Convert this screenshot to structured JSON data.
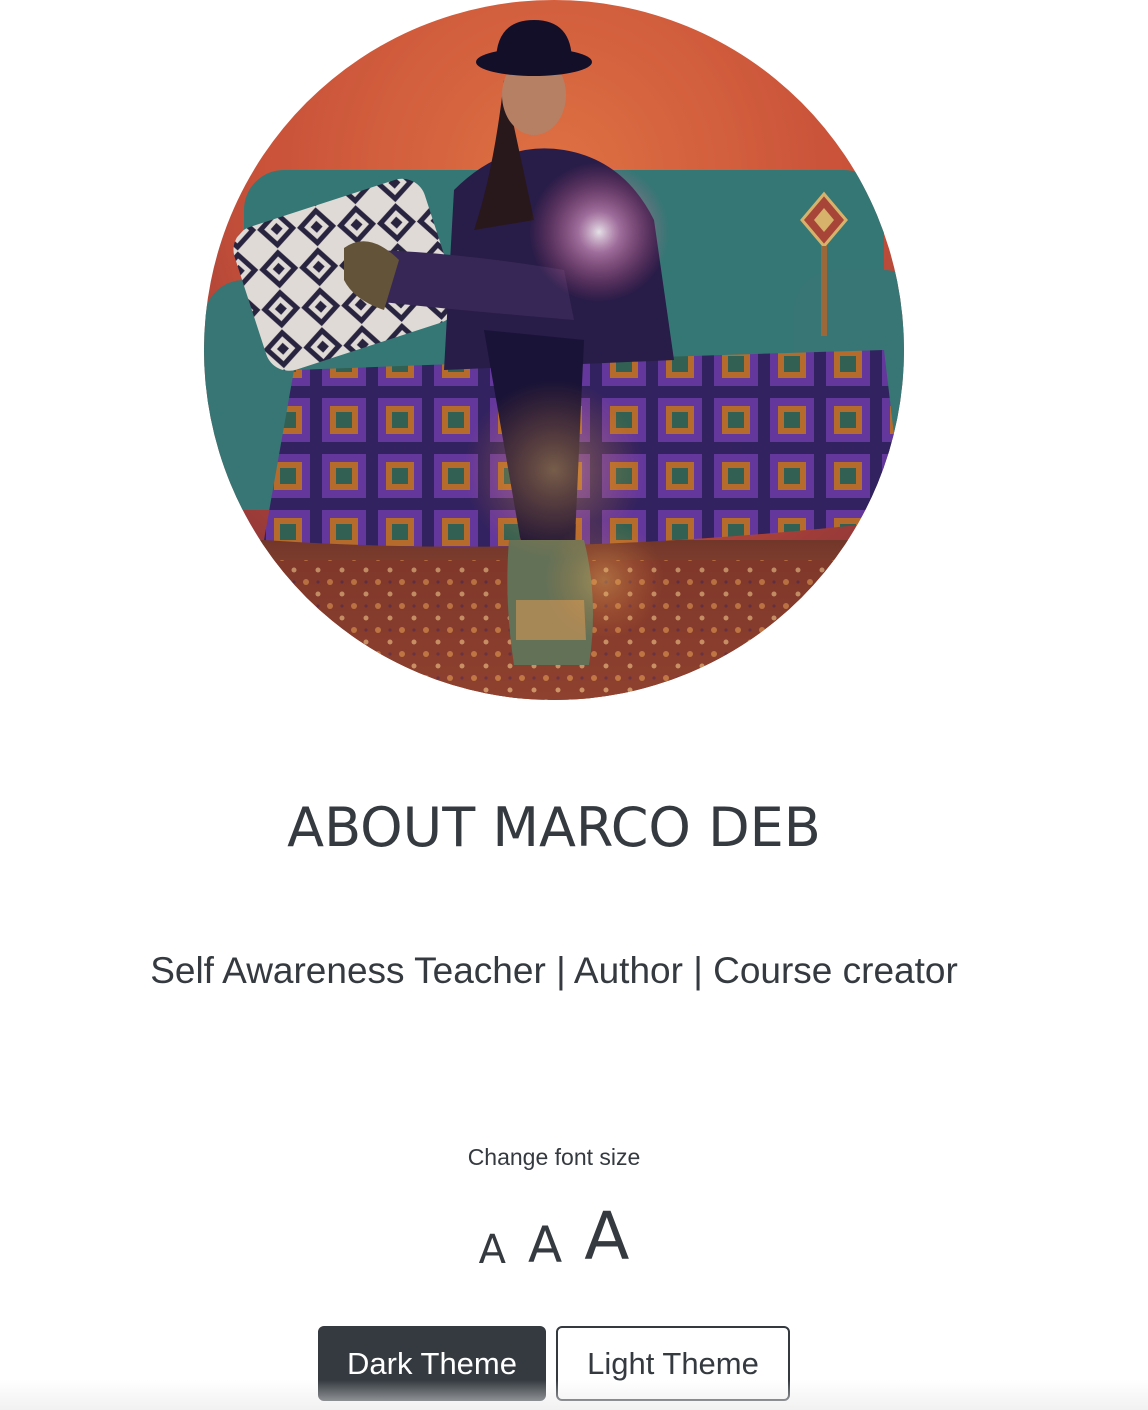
{
  "profile": {
    "image_alt": "Portrait of Marco Deb sitting on a teal sofa"
  },
  "about": {
    "title": "ABOUT MARCO DEB",
    "subtitle": "Self Awareness Teacher | Author | Course creator"
  },
  "font_controls": {
    "label": "Change font size",
    "small": "A",
    "medium": "A",
    "large": "A"
  },
  "theme": {
    "dark_label": "Dark Theme",
    "light_label": "Light Theme"
  },
  "colors": {
    "text": "#343a40",
    "dark_button_bg": "#343a40",
    "background": "#ffffff"
  }
}
